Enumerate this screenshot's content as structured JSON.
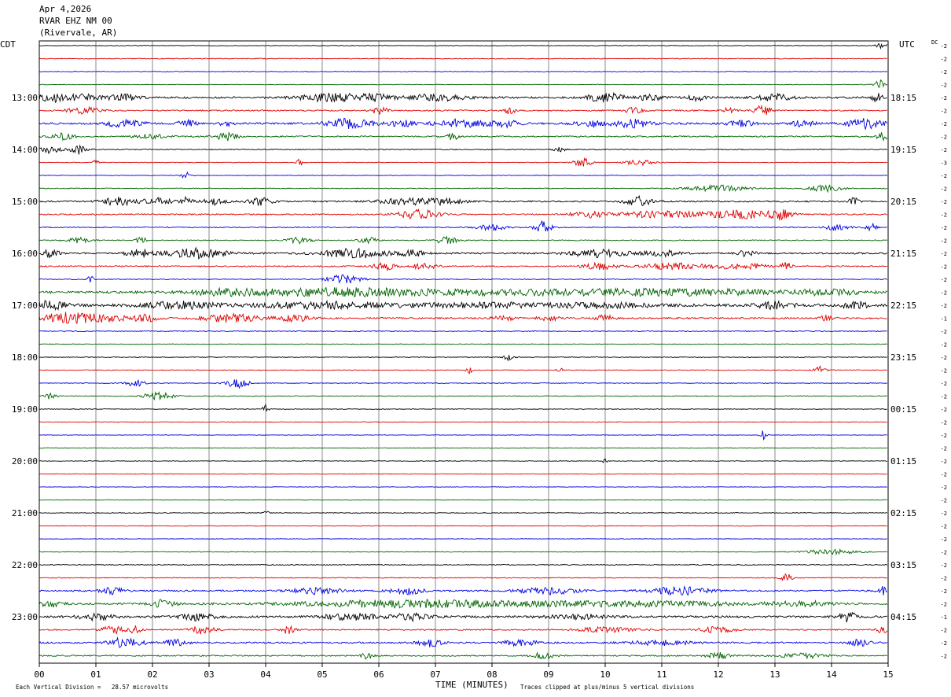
{
  "header": {
    "date": "Apr 4,2026",
    "station": "RVAR EHZ NM 00",
    "location": "(Rivervale, AR)"
  },
  "left_timezone": "CDT",
  "right_timezone": "UTC",
  "dc_label": "DC",
  "footer": {
    "scale_note": "Each Vertical Division =   28.57 microvolts",
    "clip_note": "Traces clipped at plus/minus 5 vertical divisions",
    "x_axis_title": "TIME (MINUTES)"
  },
  "colors": {
    "trace_cycle": [
      "#000000",
      "#e00000",
      "#0000e0",
      "#006400"
    ],
    "gridline": "#8a8a8a",
    "frame": "#000000"
  },
  "chart_data": {
    "type": "line",
    "title": "RVAR EHZ NM 00",
    "xlabel": "TIME (MINUTES)",
    "xlim": [
      0,
      15
    ],
    "x_ticks": [
      "00",
      "01",
      "02",
      "03",
      "04",
      "05",
      "06",
      "07",
      "08",
      "09",
      "10",
      "11",
      "12",
      "13",
      "14",
      "15"
    ],
    "minutes_per_line": 15,
    "line_count": 48,
    "left_hour_labels": [
      {
        "line": 4,
        "label": "13:00"
      },
      {
        "line": 8,
        "label": "14:00"
      },
      {
        "line": 12,
        "label": "15:00"
      },
      {
        "line": 16,
        "label": "16:00"
      },
      {
        "line": 20,
        "label": "17:00"
      },
      {
        "line": 24,
        "label": "18:00"
      },
      {
        "line": 28,
        "label": "19:00"
      },
      {
        "line": 32,
        "label": "20:00"
      },
      {
        "line": 36,
        "label": "21:00"
      },
      {
        "line": 40,
        "label": "22:00"
      },
      {
        "line": 44,
        "label": "23:00"
      }
    ],
    "right_hour_labels": [
      {
        "line": 4,
        "label": "18:15"
      },
      {
        "line": 8,
        "label": "19:15"
      },
      {
        "line": 12,
        "label": "20:15"
      },
      {
        "line": 16,
        "label": "21:15"
      },
      {
        "line": 20,
        "label": "22:15"
      },
      {
        "line": 24,
        "label": "23:15"
      },
      {
        "line": 28,
        "label": "00:15"
      },
      {
        "line": 32,
        "label": "01:15"
      },
      {
        "line": 36,
        "label": "02:15"
      },
      {
        "line": 40,
        "label": "03:15"
      },
      {
        "line": 44,
        "label": "04:15"
      }
    ],
    "dc_offsets": [
      "-2",
      "-2",
      "-2",
      "-2",
      "-2",
      "-2",
      "-2",
      "-2",
      "-2",
      "-3",
      "-2",
      "-2",
      "-2",
      "-2",
      "-2",
      "-2",
      "-2",
      "-2",
      "-2",
      "-2",
      "-2",
      "-1",
      "-2",
      "-2",
      "-2",
      "-2",
      "-2",
      "-2",
      "-2",
      "-2",
      "-2",
      "-2",
      "-2",
      "-2",
      "-2",
      "-2",
      "-2",
      "-2",
      "-2",
      "-2",
      "-2",
      "-2",
      "-2",
      "-2",
      "-1",
      "-2",
      "-2",
      "-2"
    ],
    "trace_activity": [
      {
        "base": 0.4,
        "bursts": [
          [
            14.9,
            0.1,
            5
          ]
        ]
      },
      {
        "base": 0.5,
        "bursts": []
      },
      {
        "base": 0.4,
        "bursts": []
      },
      {
        "base": 0.4,
        "bursts": [
          [
            14.85,
            0.08,
            6
          ]
        ]
      },
      {
        "base": 1.2,
        "bursts": [
          [
            0.2,
            0.25,
            5
          ],
          [
            0.8,
            0.35,
            4
          ],
          [
            1.5,
            0.25,
            4
          ],
          [
            5.2,
            0.6,
            5
          ],
          [
            6.0,
            0.3,
            4
          ],
          [
            7.0,
            0.5,
            4
          ],
          [
            10.0,
            0.3,
            6
          ],
          [
            10.8,
            0.2,
            4
          ],
          [
            11.6,
            0.15,
            4
          ],
          [
            13.0,
            0.3,
            4
          ],
          [
            14.8,
            0.1,
            5
          ]
        ]
      },
      {
        "base": 0.8,
        "bursts": [
          [
            0.8,
            0.3,
            4
          ],
          [
            6.0,
            0.15,
            5
          ],
          [
            8.3,
            0.1,
            5
          ],
          [
            10.5,
            0.15,
            4
          ],
          [
            12.2,
            0.1,
            4
          ],
          [
            12.8,
            0.15,
            7
          ]
        ]
      },
      {
        "base": 1.2,
        "bursts": [
          [
            1.5,
            0.3,
            5
          ],
          [
            2.6,
            0.15,
            5
          ],
          [
            3.3,
            0.1,
            4
          ],
          [
            5.5,
            0.4,
            6
          ],
          [
            6.4,
            0.2,
            4
          ],
          [
            7.5,
            0.5,
            5
          ],
          [
            8.3,
            0.2,
            4
          ],
          [
            9.8,
            0.3,
            4
          ],
          [
            10.5,
            0.3,
            5
          ],
          [
            12.4,
            0.2,
            5
          ],
          [
            13.5,
            0.2,
            4
          ],
          [
            14.6,
            0.3,
            6
          ]
        ]
      },
      {
        "base": 0.8,
        "bursts": [
          [
            0.4,
            0.2,
            4
          ],
          [
            2.0,
            0.3,
            3
          ],
          [
            3.3,
            0.2,
            5
          ],
          [
            7.3,
            0.1,
            5
          ],
          [
            14.9,
            0.1,
            5
          ]
        ]
      },
      {
        "base": 0.6,
        "bursts": [
          [
            0.2,
            0.2,
            5
          ],
          [
            0.7,
            0.15,
            6
          ],
          [
            9.2,
            0.1,
            3
          ]
        ]
      },
      {
        "base": 0.4,
        "bursts": [
          [
            1.0,
            0.05,
            4
          ],
          [
            4.6,
            0.05,
            5
          ],
          [
            9.6,
            0.15,
            6
          ],
          [
            10.6,
            0.25,
            4
          ]
        ]
      },
      {
        "base": 0.4,
        "bursts": [
          [
            2.6,
            0.1,
            4
          ]
        ]
      },
      {
        "base": 0.5,
        "bursts": [
          [
            12.0,
            0.5,
            4
          ],
          [
            13.9,
            0.3,
            4
          ]
        ]
      },
      {
        "base": 0.9,
        "bursts": [
          [
            1.4,
            0.3,
            5
          ],
          [
            2.1,
            0.25,
            4
          ],
          [
            2.6,
            0.1,
            6
          ],
          [
            3.1,
            0.2,
            4
          ],
          [
            3.9,
            0.2,
            5
          ],
          [
            6.5,
            0.5,
            4
          ],
          [
            7.2,
            0.3,
            4
          ],
          [
            10.6,
            0.25,
            6
          ],
          [
            14.4,
            0.1,
            5
          ]
        ]
      },
      {
        "base": 0.8,
        "bursts": [
          [
            6.7,
            0.35,
            6
          ],
          [
            9.7,
            0.3,
            4
          ],
          [
            11.0,
            0.8,
            4
          ],
          [
            12.4,
            0.6,
            5
          ],
          [
            13.1,
            0.2,
            6
          ]
        ]
      },
      {
        "base": 0.6,
        "bursts": [
          [
            8.0,
            0.25,
            4
          ],
          [
            8.9,
            0.15,
            8
          ],
          [
            14.1,
            0.2,
            4
          ],
          [
            14.7,
            0.1,
            5
          ]
        ]
      },
      {
        "base": 0.6,
        "bursts": [
          [
            0.7,
            0.2,
            4
          ],
          [
            1.8,
            0.1,
            4
          ],
          [
            4.6,
            0.2,
            4
          ],
          [
            5.8,
            0.15,
            5
          ],
          [
            7.2,
            0.2,
            5
          ]
        ]
      },
      {
        "base": 1.0,
        "bursts": [
          [
            0.2,
            0.15,
            5
          ],
          [
            1.8,
            0.25,
            5
          ],
          [
            2.8,
            0.5,
            6
          ],
          [
            5.6,
            0.6,
            6
          ],
          [
            6.6,
            0.2,
            4
          ],
          [
            9.9,
            0.5,
            5
          ],
          [
            11.0,
            0.3,
            4
          ],
          [
            12.5,
            0.15,
            4
          ]
        ]
      },
      {
        "base": 0.8,
        "bursts": [
          [
            6.1,
            0.2,
            5
          ],
          [
            6.8,
            0.2,
            4
          ],
          [
            9.9,
            0.3,
            4
          ],
          [
            11.2,
            0.5,
            4
          ],
          [
            12.4,
            0.5,
            4
          ],
          [
            13.2,
            0.1,
            5
          ]
        ]
      },
      {
        "base": 0.5,
        "bursts": [
          [
            0.9,
            0.05,
            5
          ],
          [
            5.4,
            0.3,
            6
          ]
        ]
      },
      {
        "base": 1.4,
        "bursts": [
          [
            3.2,
            0.5,
            3
          ],
          [
            5.0,
            1.5,
            3
          ],
          [
            7.5,
            3.5,
            3
          ],
          [
            11.5,
            2.0,
            3
          ],
          [
            14.0,
            0.5,
            3
          ]
        ]
      },
      {
        "base": 1.8,
        "bursts": [
          [
            0.2,
            0.3,
            5
          ],
          [
            2.5,
            0.6,
            4
          ],
          [
            5.0,
            1.0,
            4
          ],
          [
            7.8,
            1.2,
            3
          ],
          [
            10.0,
            0.8,
            3
          ],
          [
            13.0,
            0.3,
            4
          ],
          [
            14.4,
            0.2,
            5
          ]
        ]
      },
      {
        "base": 1.0,
        "bursts": [
          [
            0.4,
            0.3,
            6
          ],
          [
            1.0,
            0.6,
            5
          ],
          [
            1.9,
            0.2,
            4
          ],
          [
            3.4,
            0.5,
            5
          ],
          [
            4.5,
            0.3,
            4
          ],
          [
            8.2,
            0.2,
            3
          ],
          [
            9.0,
            0.2,
            3
          ],
          [
            10.0,
            0.15,
            4
          ],
          [
            13.9,
            0.1,
            5
          ]
        ]
      },
      {
        "base": 0.5,
        "bursts": []
      },
      {
        "base": 0.4,
        "bursts": []
      },
      {
        "base": 0.4,
        "bursts": [
          [
            8.3,
            0.1,
            4
          ]
        ]
      },
      {
        "base": 0.5,
        "bursts": [
          [
            7.6,
            0.05,
            5
          ],
          [
            9.2,
            0.05,
            4
          ],
          [
            13.8,
            0.1,
            5
          ]
        ]
      },
      {
        "base": 0.4,
        "bursts": [
          [
            1.7,
            0.15,
            5
          ],
          [
            3.5,
            0.2,
            6
          ]
        ]
      },
      {
        "base": 0.5,
        "bursts": [
          [
            0.2,
            0.1,
            4
          ],
          [
            2.1,
            0.25,
            5
          ]
        ]
      },
      {
        "base": 0.4,
        "bursts": [
          [
            4.0,
            0.05,
            6
          ]
        ]
      },
      {
        "base": 0.4,
        "bursts": []
      },
      {
        "base": 0.3,
        "bursts": [
          [
            12.8,
            0.05,
            6
          ]
        ]
      },
      {
        "base": 0.4,
        "bursts": []
      },
      {
        "base": 0.4,
        "bursts": [
          [
            10.0,
            0.05,
            3
          ]
        ]
      },
      {
        "base": 0.4,
        "bursts": []
      },
      {
        "base": 0.3,
        "bursts": []
      },
      {
        "base": 0.4,
        "bursts": []
      },
      {
        "base": 0.4,
        "bursts": [
          [
            4.0,
            0.05,
            4
          ]
        ]
      },
      {
        "base": 0.4,
        "bursts": []
      },
      {
        "base": 0.3,
        "bursts": []
      },
      {
        "base": 0.4,
        "bursts": [
          [
            14.0,
            0.5,
            3
          ]
        ]
      },
      {
        "base": 0.5,
        "bursts": []
      },
      {
        "base": 0.5,
        "bursts": [
          [
            13.2,
            0.1,
            5
          ]
        ]
      },
      {
        "base": 1.0,
        "bursts": [
          [
            1.3,
            0.2,
            4
          ],
          [
            4.9,
            0.4,
            4
          ],
          [
            6.5,
            0.3,
            4
          ],
          [
            9.0,
            0.5,
            4
          ],
          [
            11.3,
            0.5,
            5
          ],
          [
            14.9,
            0.1,
            6
          ]
        ]
      },
      {
        "base": 1.2,
        "bursts": [
          [
            0.2,
            0.2,
            4
          ],
          [
            2.2,
            0.2,
            5
          ],
          [
            5.8,
            1.5,
            3
          ],
          [
            7.5,
            1.5,
            3
          ],
          [
            10.5,
            2.0,
            3
          ],
          [
            13.5,
            0.5,
            3
          ]
        ]
      },
      {
        "base": 1.3,
        "bursts": [
          [
            1.0,
            0.3,
            4
          ],
          [
            2.8,
            0.3,
            4
          ],
          [
            5.5,
            0.5,
            4
          ],
          [
            6.6,
            0.3,
            5
          ],
          [
            9.5,
            0.5,
            3
          ],
          [
            14.3,
            0.15,
            6
          ]
        ]
      },
      {
        "base": 0.8,
        "bursts": [
          [
            1.3,
            0.2,
            5
          ],
          [
            1.7,
            0.1,
            5
          ],
          [
            2.9,
            0.2,
            6
          ],
          [
            4.4,
            0.1,
            6
          ],
          [
            10.0,
            0.5,
            3
          ],
          [
            12.0,
            0.3,
            4
          ],
          [
            14.9,
            0.1,
            4
          ]
        ]
      },
      {
        "base": 1.0,
        "bursts": [
          [
            1.5,
            0.3,
            6
          ],
          [
            2.4,
            0.2,
            4
          ],
          [
            6.9,
            0.2,
            5
          ],
          [
            8.5,
            0.3,
            4
          ],
          [
            11.0,
            0.5,
            3
          ],
          [
            14.5,
            0.2,
            4
          ]
        ]
      },
      {
        "base": 0.8,
        "bursts": [
          [
            5.8,
            0.1,
            4
          ],
          [
            8.9,
            0.2,
            4
          ],
          [
            12.0,
            0.2,
            4
          ],
          [
            13.5,
            0.4,
            3
          ]
        ]
      }
    ]
  }
}
